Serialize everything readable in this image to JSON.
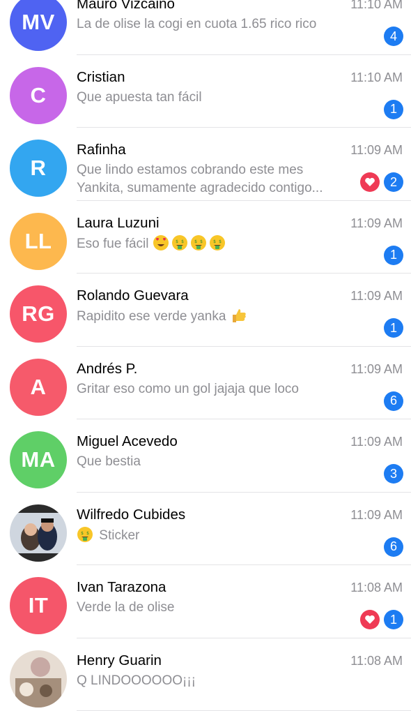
{
  "chats": [
    {
      "name": "Mauro Vizcaino",
      "initials": "MV",
      "color": "#4f63f2",
      "time": "11:10 AM",
      "message": [
        "La de olise la cogi en cuota 1.65 rico rico"
      ],
      "unread": "4",
      "reaction": false,
      "avatar_type": "initials"
    },
    {
      "name": "Cristian",
      "initials": "C",
      "color": "#c767e8",
      "time": "11:10 AM",
      "message": [
        "Que apuesta tan fácil"
      ],
      "unread": "1",
      "reaction": false,
      "avatar_type": "initials"
    },
    {
      "name": "Rafinha",
      "initials": "R",
      "color": "#33a6f0",
      "time": "11:09 AM",
      "message": [
        "Que lindo estamos cobrando este mes",
        "Yankita, sumamente agradecido contigo..."
      ],
      "unread": "2",
      "reaction": true,
      "avatar_type": "initials"
    },
    {
      "name": "Laura Luzuni",
      "initials": "LL",
      "color": "#fdb84e",
      "time": "11:09 AM",
      "message": [
        "Eso fue fácil"
      ],
      "emojis": [
        "heart-eyes-emoji",
        "money-face-emoji",
        "money-face-emoji",
        "money-face-emoji"
      ],
      "unread": "1",
      "reaction": false,
      "avatar_type": "initials"
    },
    {
      "name": "Rolando Guevara",
      "initials": "RG",
      "color": "#f7566a",
      "time": "11:09 AM",
      "message": [
        "Rapidito ese verde yanka"
      ],
      "emojis_after": [
        "thumbs-up-emoji"
      ],
      "unread": "1",
      "reaction": false,
      "avatar_type": "initials"
    },
    {
      "name": "Andrés P.",
      "initials": "A",
      "color": "#f65a6b",
      "time": "11:09 AM",
      "message": [
        "Gritar eso como un gol jajaja que loco"
      ],
      "unread": "6",
      "reaction": false,
      "avatar_type": "initials"
    },
    {
      "name": "Miguel Acevedo",
      "initials": "MA",
      "color": "#5fcf67",
      "time": "11:09 AM",
      "message": [
        "Que bestia"
      ],
      "unread": "3",
      "reaction": false,
      "avatar_type": "initials"
    },
    {
      "name": "Wilfredo Cubides",
      "initials": "",
      "color": "#6b7c8c",
      "time": "11:09 AM",
      "message": [
        "Sticker"
      ],
      "emojis": [
        "money-face-emoji"
      ],
      "unread": "6",
      "reaction": false,
      "avatar_type": "photo"
    },
    {
      "name": "Ivan Tarazona",
      "initials": "IT",
      "color": "#f5566a",
      "time": "11:08 AM",
      "message": [
        "Verde la de olise"
      ],
      "unread": "1",
      "reaction": true,
      "avatar_type": "initials"
    },
    {
      "name": "Henry Guarin",
      "initials": "",
      "color": "#b89b86",
      "time": "11:08 AM",
      "message": [
        "Q LINDOOOOOO¡¡¡"
      ],
      "unread": "",
      "reaction": false,
      "avatar_type": "photo"
    }
  ]
}
